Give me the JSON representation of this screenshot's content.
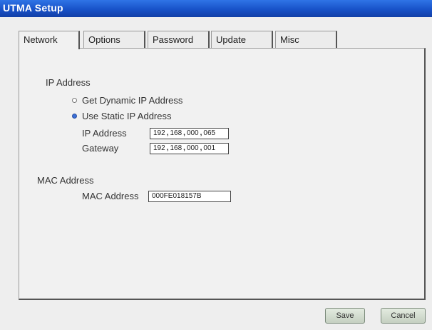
{
  "window": {
    "title": "UTMA Setup"
  },
  "tabs": [
    {
      "label": "Network",
      "active": true
    },
    {
      "label": "Options",
      "active": false
    },
    {
      "label": "Password",
      "active": false
    },
    {
      "label": "Update",
      "active": false
    },
    {
      "label": "Misc",
      "active": false
    }
  ],
  "network": {
    "ip_section": {
      "heading": "IP Address",
      "dynamic_label": "Get Dynamic IP Address",
      "static_label": "Use Static IP Address",
      "selected": "static",
      "ip_label": "IP Address",
      "ip_octets": [
        "192",
        "168",
        "000",
        "065"
      ],
      "gateway_label": "Gateway",
      "gateway_octets": [
        "192",
        "168",
        "000",
        "001"
      ]
    },
    "mac_section": {
      "heading": "MAC Address",
      "mac_label": "MAC Address",
      "mac_value": "000FE018157B"
    }
  },
  "buttons": {
    "save": "Save",
    "cancel": "Cancel"
  },
  "colors": {
    "titlebar": "#1852c8",
    "radio_selected": "#3a6fd8",
    "button": "#c5d0c1"
  }
}
